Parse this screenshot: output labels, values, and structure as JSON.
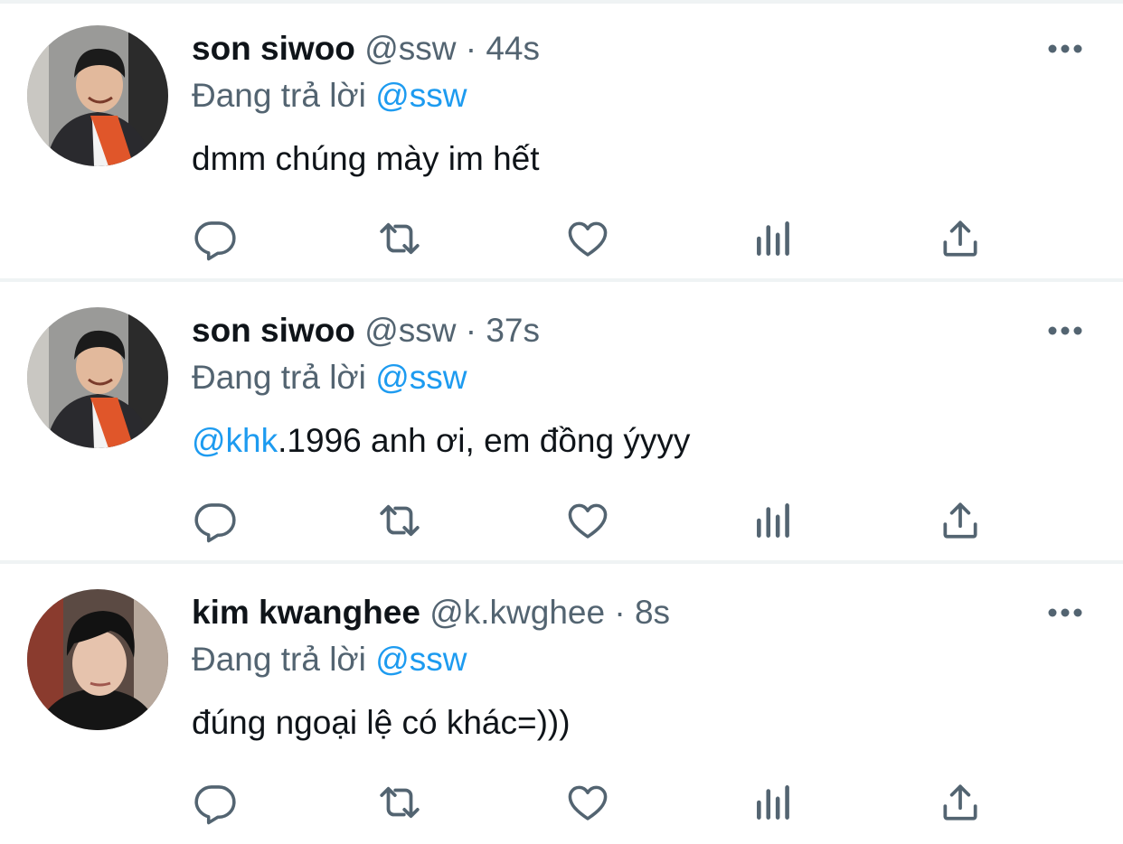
{
  "reply_prefix": "Đang trả lời",
  "separator": "·",
  "colors": {
    "text": "#0f1419",
    "secondary": "#536471",
    "link": "#1d9bf0",
    "divider": "#eff3f4"
  },
  "action_icons": [
    "reply-icon",
    "retweet-icon",
    "like-icon",
    "views-icon",
    "share-icon"
  ],
  "tweets": [
    {
      "display_name": "son siwoo",
      "handle": "@ssw",
      "time": "44s",
      "replying_to": "@ssw",
      "text_mention": "",
      "text": "dmm chúng mày im hết"
    },
    {
      "display_name": "son siwoo",
      "handle": "@ssw",
      "time": "37s",
      "replying_to": "@ssw",
      "text_mention": "@khk",
      "text": ".1996 anh ơi, em đồng ýyyy"
    },
    {
      "display_name": "kim kwanghee",
      "handle": "@k.kwghee",
      "time": "8s",
      "replying_to": "@ssw",
      "text_mention": "",
      "text": "đúng ngoại lệ có khác=)))"
    }
  ]
}
